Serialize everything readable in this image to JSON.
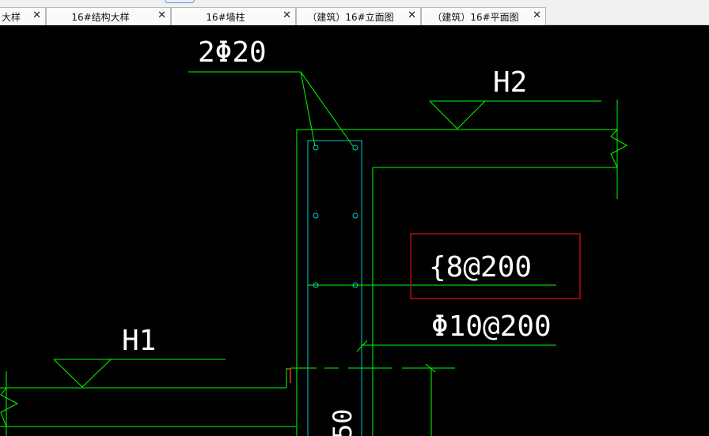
{
  "tabs": [
    {
      "label": "大样",
      "close": "✕"
    },
    {
      "label": "16#结构大样",
      "close": "✕"
    },
    {
      "label": "16#墙柱",
      "close": "✕"
    },
    {
      "label": "（建筑）16#立面图",
      "close": "✕"
    },
    {
      "label": "（建筑）16#平面图",
      "close": "✕"
    }
  ],
  "drawing": {
    "rebar_top": "2Φ20",
    "level_h2": "H2",
    "level_h1": "H1",
    "stirrup_boxed": "{8@200",
    "distribution_bar": "Φ10@200",
    "dimension_partial": "50"
  },
  "colors": {
    "background": "#000000",
    "wall_lines": "#00ff00",
    "column_lines": "#00cccc",
    "text": "#ffffff",
    "highlight_box": "#e01010",
    "detail_orange": "#ff5a1a"
  }
}
